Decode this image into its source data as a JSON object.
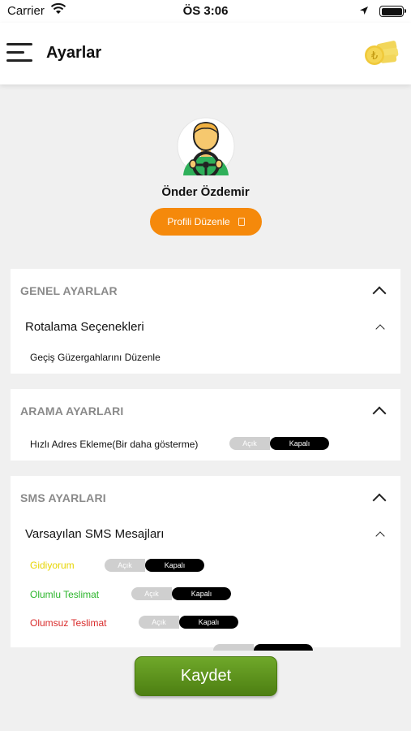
{
  "status": {
    "carrier": "Carrier",
    "time": "ÖS 3:06"
  },
  "header": {
    "title": "Ayarlar",
    "menu_icon": "hamburger-menu-icon",
    "money_icon": "money-coins-icon"
  },
  "profile": {
    "name": "Önder Özdemir",
    "edit_label": "Profili Düzenle",
    "avatar": "driver-avatar"
  },
  "general": {
    "title": "GENEL AYARLAR",
    "routing_title": "Rotalama Seçenekleri",
    "edit_routes": "Geçiş Güzergahlarını Düzenle"
  },
  "search": {
    "title": "ARAMA AYARLARI",
    "quick_add_label": "Hızlı Adres Ekleme(Bir daha gösterme)",
    "on_label": "Açık",
    "off_label": "Kapalı"
  },
  "sms": {
    "title": "SMS AYARLARI",
    "default_title": "Varsayılan SMS Mesajları",
    "items": [
      {
        "label": "Gidiyorum",
        "color": "#e6d400",
        "on": "Açık",
        "off": "Kapalı"
      },
      {
        "label": "Olumlu Teslimat",
        "color": "#2bb52b",
        "on": "Açık",
        "off": "Kapalı"
      },
      {
        "label": "Olumsuz Teslimat",
        "color": "#d92b2b",
        "on": "Açık",
        "off": "Kapalı"
      }
    ]
  },
  "save_label": "Kaydet",
  "colors": {
    "accent_orange": "#f5890b",
    "save_green": "#5a8f1a"
  }
}
